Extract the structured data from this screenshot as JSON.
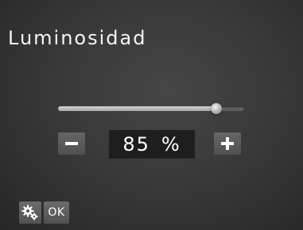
{
  "screen": {
    "title": "Luminosidad"
  },
  "brightness": {
    "value": "85",
    "unit": "%",
    "level": 0.85
  },
  "controls": {
    "decrease_icon": "minus-icon",
    "increase_icon": "plus-icon",
    "settings_icon": "gears-icon",
    "ok_label": "OK"
  }
}
